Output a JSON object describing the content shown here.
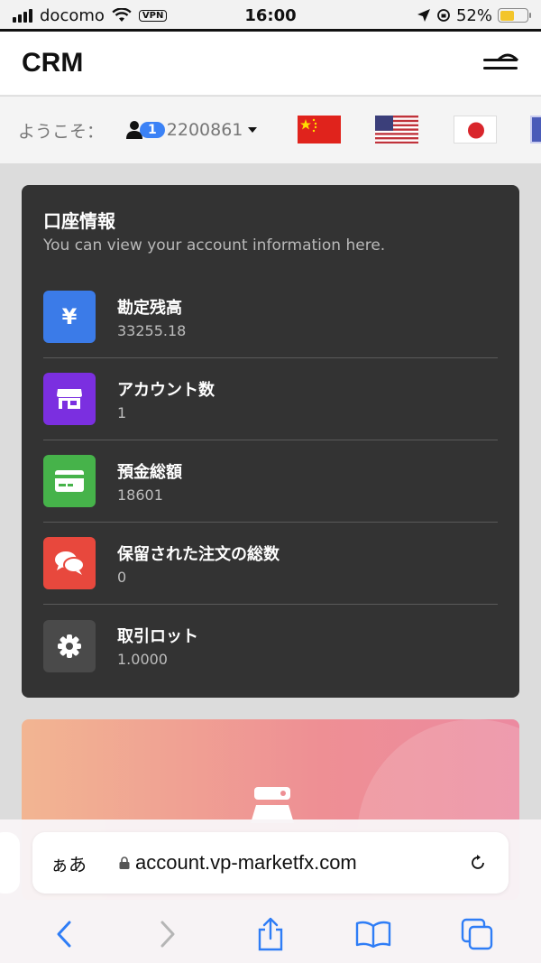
{
  "status_bar": {
    "carrier": "docomo",
    "vpn": "VPN",
    "time": "16:00",
    "battery": "52%",
    "battery_level": 0.52
  },
  "header": {
    "brand": "CRM",
    "menu_icon": "hamburger-menu-icon"
  },
  "welcome": {
    "label": "ようこそ：",
    "badge": "1",
    "user_id": "2200861",
    "flags": [
      "china-flag",
      "usa-flag",
      "japan-flag",
      "other-flag"
    ]
  },
  "account": {
    "title": "口座情報",
    "subtitle": "You can view your account information here.",
    "items": [
      {
        "label": "勘定残高",
        "value": "33255.18",
        "icon": "yen-icon",
        "color": "#3b7be8"
      },
      {
        "label": "アカウント数",
        "value": "1",
        "icon": "store-icon",
        "color": "#7b2fe0"
      },
      {
        "label": "預金総額",
        "value": "18601",
        "icon": "credit-card-icon",
        "color": "#46b34a"
      },
      {
        "label": "保留された注文の総数",
        "value": "0",
        "icon": "chat-icon",
        "color": "#e8483d"
      },
      {
        "label": "取引ロット",
        "value": "1.0000",
        "icon": "gear-icon",
        "color": "#4a4a4a"
      }
    ]
  },
  "safari": {
    "aa": "ぁあ",
    "url": "account.vp-marketfx.com"
  }
}
